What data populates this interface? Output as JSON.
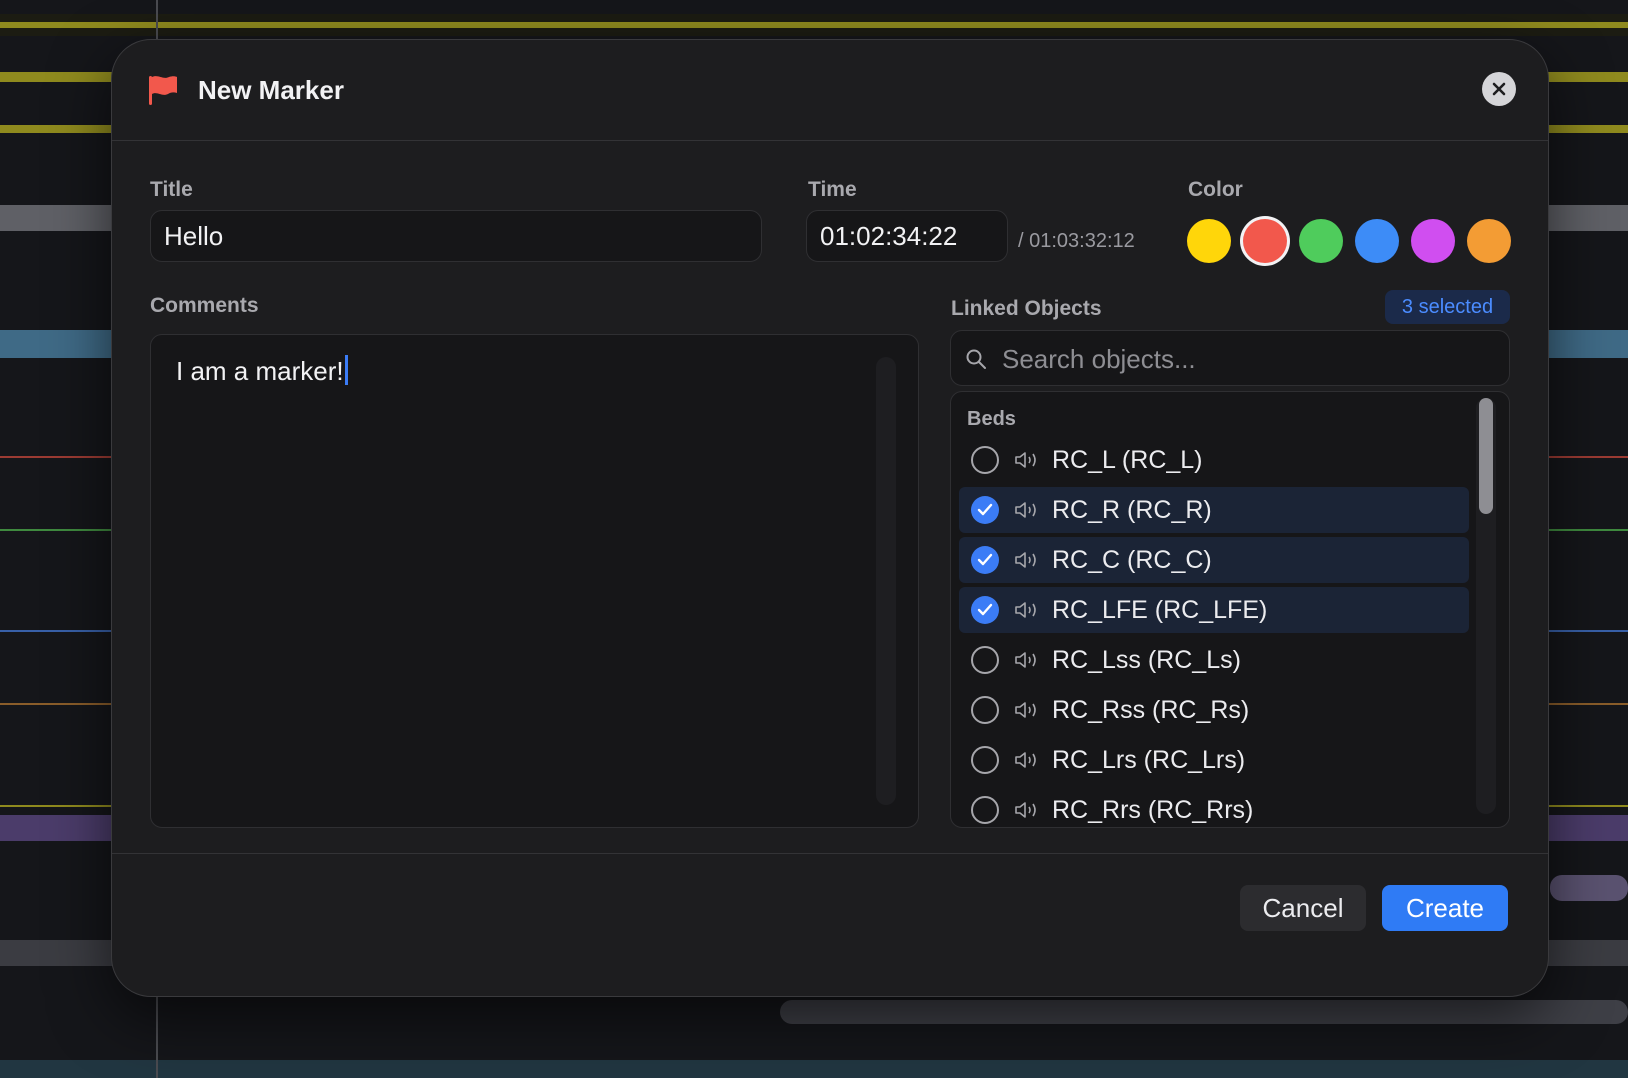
{
  "dialog": {
    "title": "New Marker",
    "close_icon": "close-icon",
    "flag_icon": "flag-icon"
  },
  "title_field": {
    "label": "Title",
    "value": "Hello"
  },
  "time_field": {
    "label": "Time",
    "value": "01:02:34:22",
    "total": "/ 01:03:32:12"
  },
  "color_picker": {
    "label": "Color",
    "swatches": [
      {
        "name": "yellow",
        "hex": "#ffd60a",
        "selected": false
      },
      {
        "name": "red",
        "hex": "#f2584c",
        "selected": true
      },
      {
        "name": "green",
        "hex": "#4fcc5c",
        "selected": false
      },
      {
        "name": "blue",
        "hex": "#3d8cf7",
        "selected": false
      },
      {
        "name": "purple",
        "hex": "#d04ef0",
        "selected": false
      },
      {
        "name": "orange",
        "hex": "#f39c34",
        "selected": false
      }
    ]
  },
  "comments": {
    "label": "Comments",
    "value": "I am a marker!"
  },
  "linked_objects": {
    "label": "Linked Objects",
    "selected_count": "3 selected",
    "search_placeholder": "Search objects...",
    "group": "Beds",
    "items": [
      {
        "label": "RC_L (RC_L)",
        "checked": false
      },
      {
        "label": "RC_R (RC_R)",
        "checked": true
      },
      {
        "label": "RC_C (RC_C)",
        "checked": true
      },
      {
        "label": "RC_LFE (RC_LFE)",
        "checked": true
      },
      {
        "label": "RC_Lss (RC_Ls)",
        "checked": false
      },
      {
        "label": "RC_Rss (RC_Rs)",
        "checked": false
      },
      {
        "label": "RC_Lrs (RC_Lrs)",
        "checked": false
      },
      {
        "label": "RC_Rrs (RC_Rrs)",
        "checked": false
      }
    ]
  },
  "footer": {
    "cancel_label": "Cancel",
    "create_label": "Create"
  },
  "colors": {
    "accent": "#2f7bf5",
    "dialog_bg": "#1d1d1f",
    "flag": "#f2584c"
  }
}
